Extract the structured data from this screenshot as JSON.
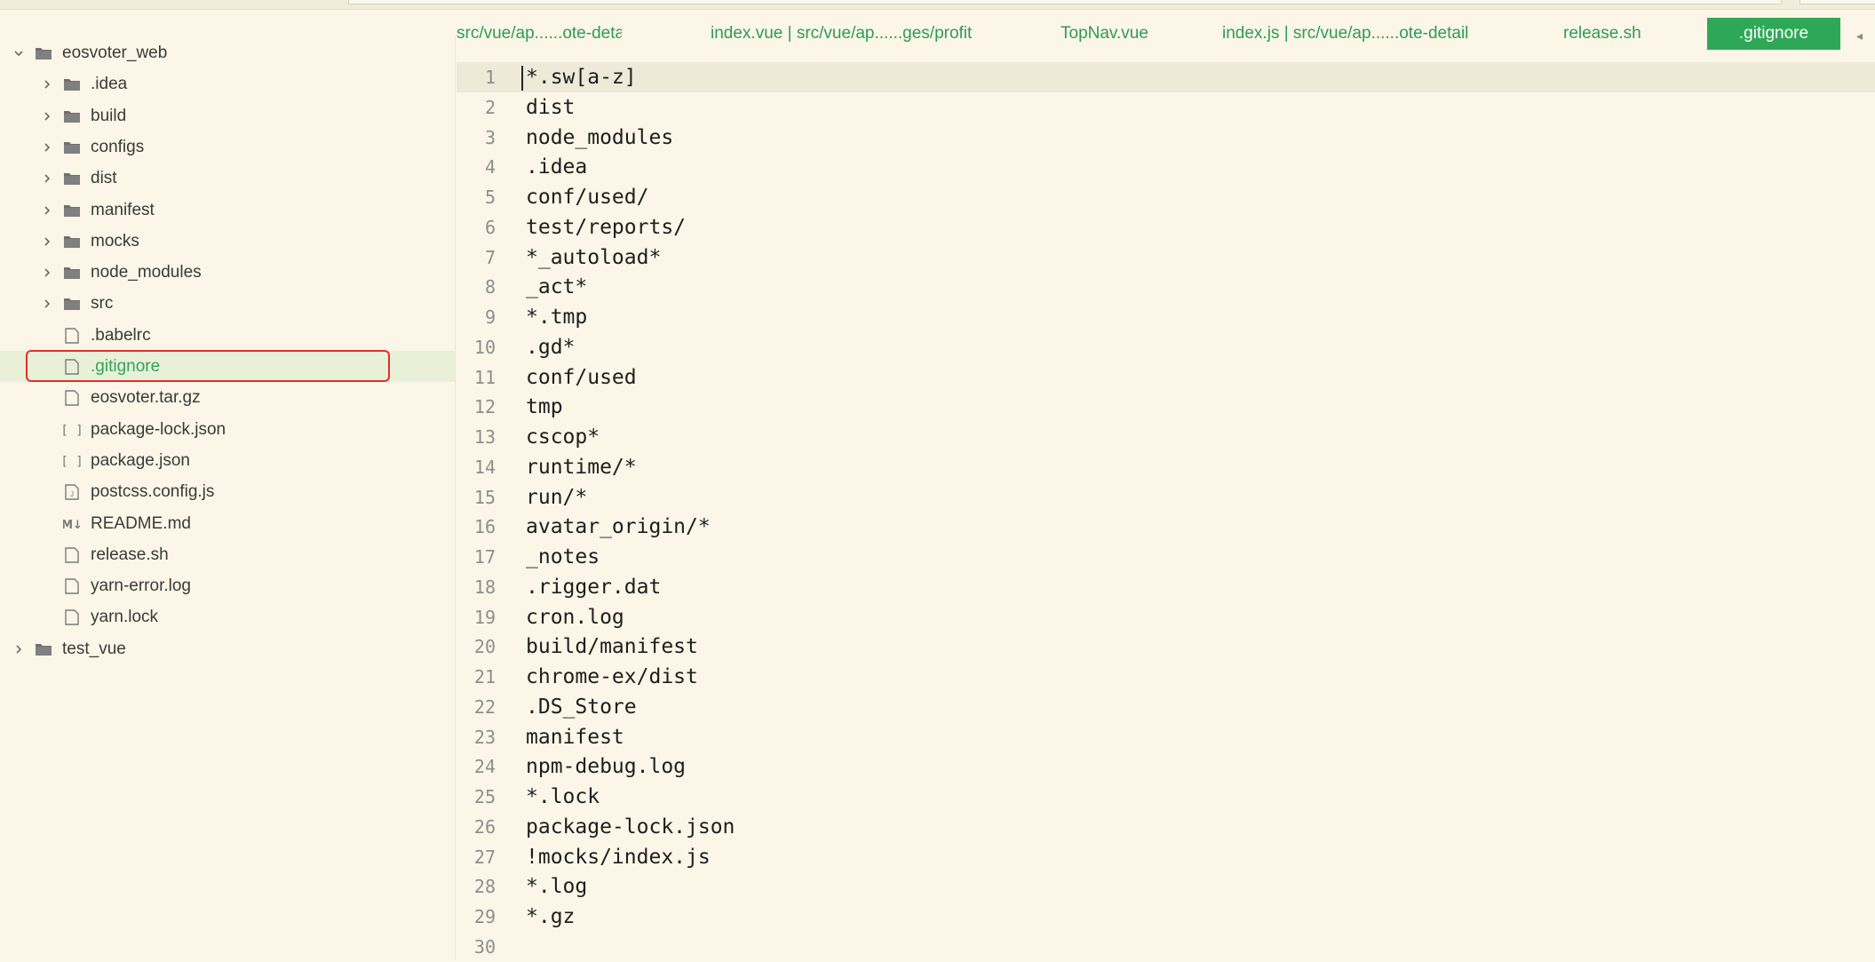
{
  "tabs": [
    {
      "label": "src/vue/ap......ote-detail",
      "active": false
    },
    {
      "label": "index.vue | src/vue/ap......ges/profit",
      "active": false
    },
    {
      "label": "TopNav.vue",
      "active": false
    },
    {
      "label": "index.js | src/vue/ap......ote-detail",
      "active": false
    },
    {
      "label": "release.sh",
      "active": false
    },
    {
      "label": ".gitignore",
      "active": true
    }
  ],
  "tab_scroll_icon": "left-arrow-icon",
  "file_tree": [
    {
      "label": "eosvoter_web",
      "type": "folder",
      "expanded": true,
      "depth": 0
    },
    {
      "label": ".idea",
      "type": "folder",
      "expanded": false,
      "depth": 1
    },
    {
      "label": "build",
      "type": "folder",
      "expanded": false,
      "depth": 1
    },
    {
      "label": "configs",
      "type": "folder",
      "expanded": false,
      "depth": 1
    },
    {
      "label": "dist",
      "type": "folder",
      "expanded": false,
      "depth": 1
    },
    {
      "label": "manifest",
      "type": "folder",
      "expanded": false,
      "depth": 1
    },
    {
      "label": "mocks",
      "type": "folder",
      "expanded": false,
      "depth": 1
    },
    {
      "label": "node_modules",
      "type": "folder",
      "expanded": false,
      "depth": 1
    },
    {
      "label": "src",
      "type": "folder",
      "expanded": false,
      "depth": 1
    },
    {
      "label": ".babelrc",
      "type": "file",
      "icon": "file-icon",
      "depth": 1
    },
    {
      "label": ".gitignore",
      "type": "file",
      "icon": "file-icon",
      "depth": 1,
      "selected": true
    },
    {
      "label": "eosvoter.tar.gz",
      "type": "file",
      "icon": "file-icon",
      "depth": 1
    },
    {
      "label": "package-lock.json",
      "type": "file",
      "icon": "json-file-icon",
      "depth": 1
    },
    {
      "label": "package.json",
      "type": "file",
      "icon": "json-file-icon",
      "depth": 1
    },
    {
      "label": "postcss.config.js",
      "type": "file",
      "icon": "js-file-icon",
      "depth": 1
    },
    {
      "label": "README.md",
      "type": "file",
      "icon": "markdown-file-icon",
      "depth": 1
    },
    {
      "label": "release.sh",
      "type": "file",
      "icon": "file-icon",
      "depth": 1
    },
    {
      "label": "yarn-error.log",
      "type": "file",
      "icon": "file-icon",
      "depth": 1
    },
    {
      "label": "yarn.lock",
      "type": "file",
      "icon": "file-icon",
      "depth": 1
    },
    {
      "label": "test_vue",
      "type": "folder",
      "expanded": false,
      "depth": 0
    }
  ],
  "editor": {
    "lines": [
      "*.sw[a-z]",
      "dist",
      "node_modules",
      ".idea",
      "conf/used/",
      "test/reports/",
      "*_autoload*",
      "_act*",
      "*.tmp",
      ".gd*",
      "conf/used",
      "tmp",
      "cscop*",
      "runtime/*",
      "run/*",
      "avatar_origin/*",
      "_notes",
      ".rigger.dat",
      "cron.log",
      "build/manifest",
      "chrome-ex/dist",
      ".DS_Store",
      "manifest",
      "npm-debug.log",
      "*.lock",
      "package-lock.json",
      "!mocks/index.js",
      "*.log",
      "*.gz",
      ""
    ],
    "line_numbers": [
      "1",
      "2",
      "3",
      "4",
      "5",
      "6",
      "7",
      "8",
      "9",
      "10",
      "11",
      "12",
      "13",
      "14",
      "15",
      "16",
      "17",
      "18",
      "19",
      "20",
      "21",
      "22",
      "23",
      "24",
      "25",
      "26",
      "27",
      "28",
      "29",
      "30"
    ]
  },
  "colors": {
    "accent": "#2ea857",
    "background": "#fbf6e7",
    "selection_outline": "#e0302a",
    "folder": "#6f6f6f"
  }
}
